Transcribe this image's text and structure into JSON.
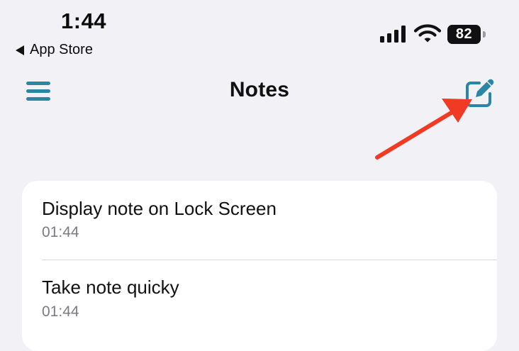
{
  "status_bar": {
    "time": "1:44",
    "back_label": "App Store",
    "battery_level": "82",
    "signal_icon": "cellular-signal-icon",
    "wifi_icon": "wifi-icon"
  },
  "nav": {
    "title": "Notes",
    "menu_icon": "hamburger-menu-icon",
    "compose_icon": "compose-note-icon"
  },
  "notes": [
    {
      "title": "Display note on Lock Screen",
      "time": "01:44"
    },
    {
      "title": "Take note quicky",
      "time": "01:44"
    }
  ],
  "colors": {
    "background": "#f2f1f6",
    "accent": "#2b86a6",
    "annotation_arrow": "#f03a24"
  }
}
